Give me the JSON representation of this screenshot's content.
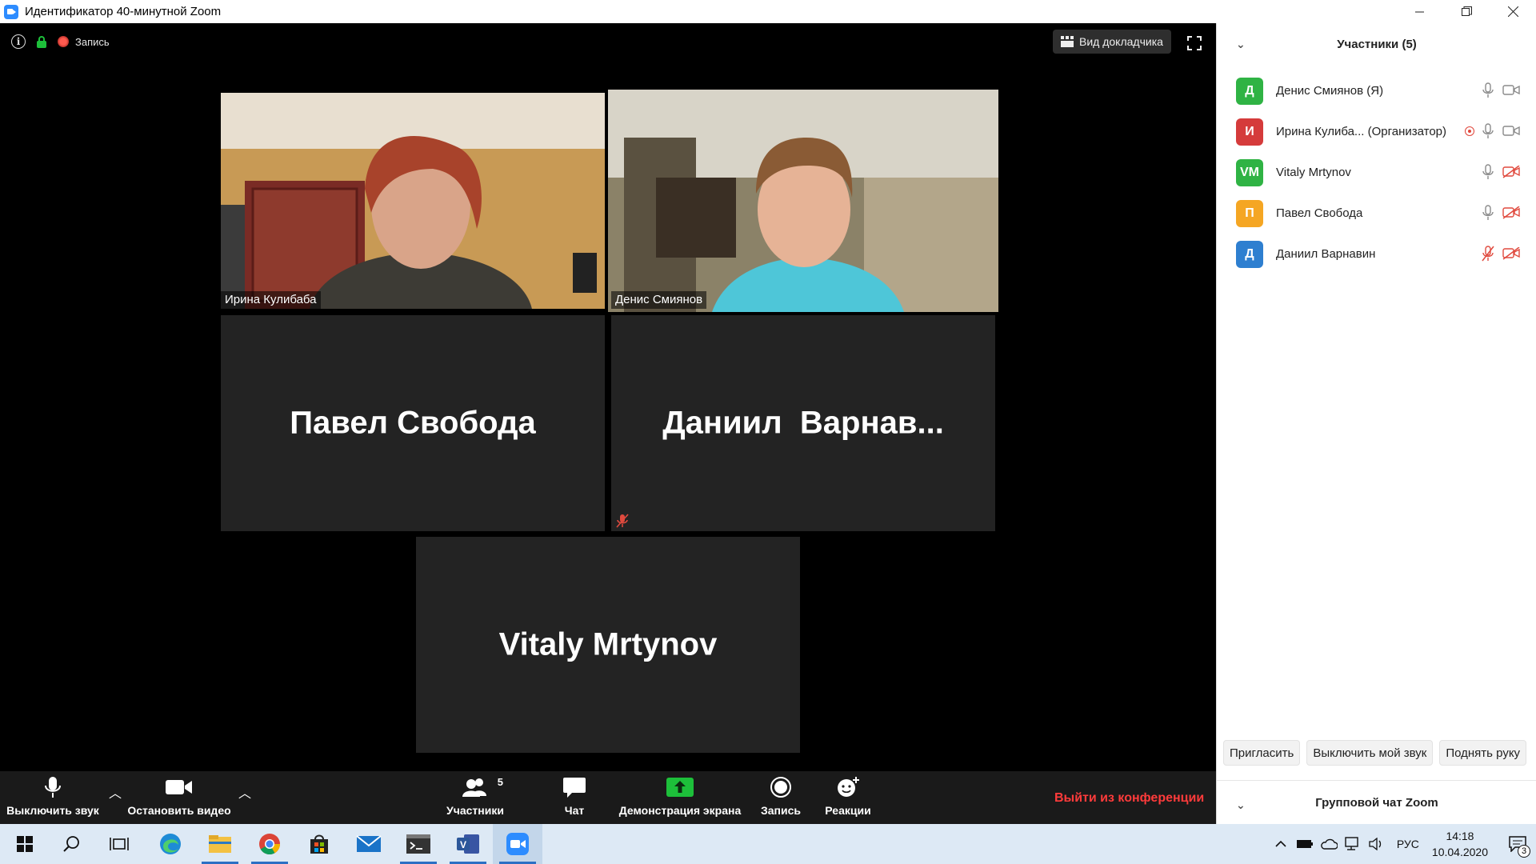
{
  "window": {
    "title": "Идентификатор 40-минутной Zoom",
    "controls": [
      "minimize-icon",
      "restore-icon",
      "close-icon"
    ]
  },
  "meeting_top": {
    "recording_label": "Запись",
    "speaker_view_label": "Вид докладчика"
  },
  "tiles": [
    {
      "name": "Ирина Кулибаба",
      "has_video": true,
      "active": false
    },
    {
      "name": "Денис Смиянов",
      "has_video": true,
      "active": true
    },
    {
      "name": "Павел Свобода",
      "has_video": false,
      "muted": false
    },
    {
      "name": "Даниил  Варнав...",
      "has_video": false,
      "muted": true
    },
    {
      "name": "Vitaly Mrtynov",
      "has_video": false,
      "muted": false
    }
  ],
  "toolbar": {
    "mute_label": "Выключить звук",
    "video_label": "Остановить видео",
    "participants_label": "Участники",
    "participants_count": "5",
    "chat_label": "Чат",
    "share_label": "Демонстрация экрана",
    "record_label": "Запись",
    "reactions_label": "Реакции",
    "leave_label": "Выйти из конференции"
  },
  "panel": {
    "title": "Участники (5)",
    "participants": [
      {
        "initials": "Д",
        "name": "Денис Смиянов (Я)",
        "color": "#2fb344",
        "mic": "on",
        "cam": "on",
        "recording": false
      },
      {
        "initials": "И",
        "name": "Ирина Кулиба... (Организатор)",
        "color": "#d53b3b",
        "mic": "on",
        "cam": "on",
        "recording": true
      },
      {
        "initials": "VM",
        "name": "Vitaly Mrtynov",
        "color": "#2fb344",
        "mic": "on",
        "cam": "off",
        "recording": false
      },
      {
        "initials": "П",
        "name": "Павел Свобода",
        "color": "#f5a623",
        "mic": "on",
        "cam": "off",
        "recording": false
      },
      {
        "initials": "Д",
        "name": "Даниил Варнавин",
        "color": "#2e7fd0",
        "mic": "off",
        "cam": "off",
        "recording": false
      }
    ],
    "invite_label": "Пригласить",
    "mute_me_label": "Выключить мой звук",
    "raise_hand_label": "Поднять руку",
    "chat_title": "Групповой чат Zoom"
  },
  "taskbar": {
    "apps": [
      "windows-start-icon",
      "search-icon",
      "task-view-icon",
      "edge-icon",
      "file-explorer-icon",
      "chrome-icon",
      "store-icon",
      "mail-icon",
      "terminal-icon",
      "visio-icon",
      "zoom-icon"
    ],
    "language": "РУС",
    "time": "14:18",
    "date": "10.04.2020",
    "notification_count": "3"
  },
  "colors": {
    "active_speaker_border": "#c8ef63",
    "leave_red": "#ff3b3b",
    "share_green": "#1dbf3a",
    "zoom_blue": "#2d8cff"
  }
}
